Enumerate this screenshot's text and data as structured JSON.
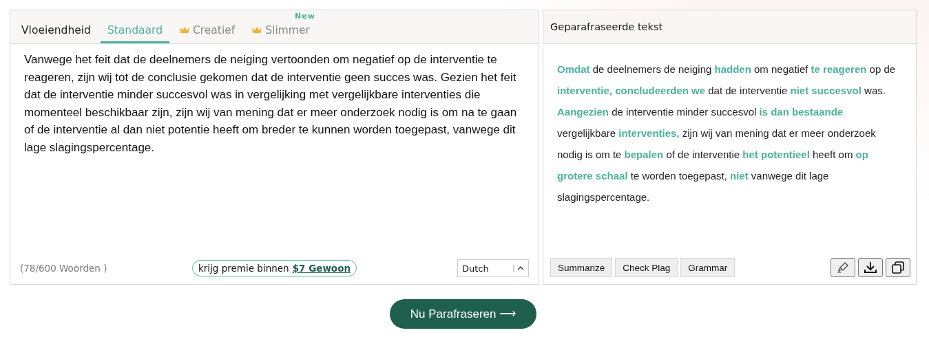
{
  "input_panel": {
    "tabs": [
      {
        "label": "Vloeiendheid",
        "selected": false,
        "kind": "plain"
      },
      {
        "label": "Standaard",
        "selected": true,
        "kind": "plain"
      },
      {
        "label": "Creatief",
        "selected": false,
        "kind": "premium"
      },
      {
        "label": "Slimmer",
        "selected": false,
        "kind": "premium",
        "badge": "New"
      }
    ],
    "text": "Vanwege het feit dat de deelnemers de neiging vertoonden om negatief op de interventie te reageren, zijn wij tot de conclusie gekomen dat de interventie geen succes was. Gezien het feit dat de interventie minder succesvol was in vergelijking met vergelijkbare interventies die momenteel beschikbaar zijn, zijn wij van mening dat er meer onderzoek nodig is om na te gaan of de interventie al dan niet potentie heeft om breder te kunnen worden toegepast, vanwege dit lage slagingspercentage.",
    "word_count": "(78/600 Woorden )",
    "promo": {
      "text": "krijg premie binnen",
      "link": "$7 Gewoon"
    },
    "language": "Dutch"
  },
  "output_panel": {
    "title": "Geparafraseerde tekst",
    "text": "**Omdat** de deelnemers de neiging **hadden** om negatief **te reageren** op de **interventie, concludeerden we** dat de interventie **niet succesvol** was. **Aangezien** de interventie minder succesvol **is dan bestaande** vergelijkbare **interventies,** zijn wij van mening dat er meer onderzoek nodig is om te **bepalen** of de interventie **het potentieel** heeft om **op grotere schaal** te worden toegepast, **niet** vanwege dit lage slagingspercentage.",
    "actions": [
      "Summarize",
      "Check Plag",
      "Grammar"
    ]
  },
  "submit": {
    "label": "Nu Parafraseren ⟶"
  }
}
